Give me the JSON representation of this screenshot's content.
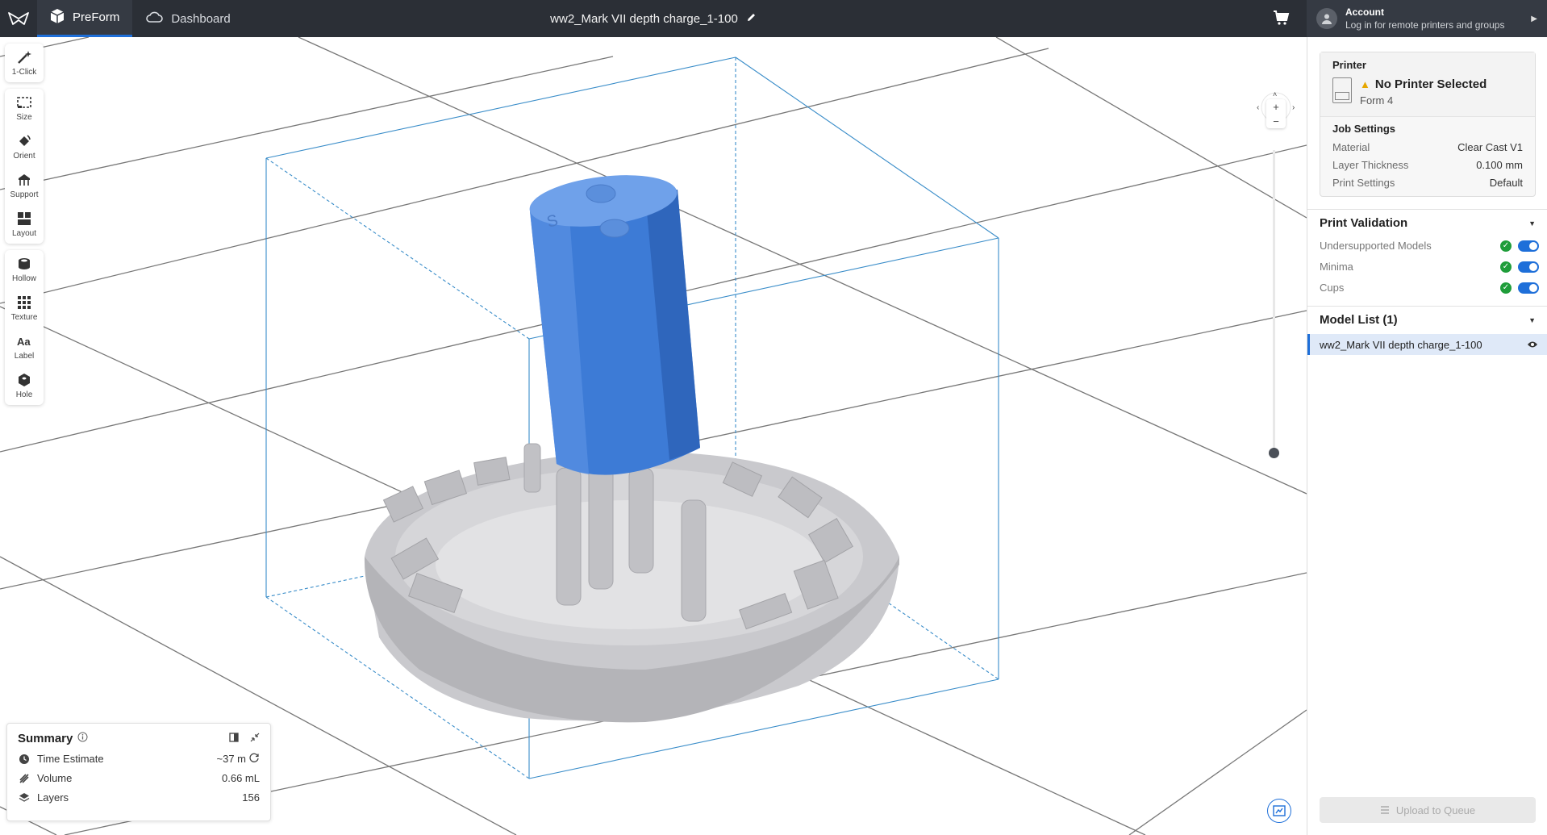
{
  "topbar": {
    "tabs": [
      {
        "label": "PreForm",
        "icon": "preform-box-icon",
        "active": true
      },
      {
        "label": "Dashboard",
        "icon": "cloud-icon",
        "active": false
      }
    ],
    "document_title": "ww2_Mark VII depth charge_1-100",
    "account": {
      "title": "Account",
      "subtitle": "Log in for remote printers and groups"
    }
  },
  "toolbar": {
    "group1": [
      {
        "label": "1-Click",
        "icon": "magic-wand-icon"
      }
    ],
    "group2": [
      {
        "label": "Size",
        "icon": "size-icon"
      },
      {
        "label": "Orient",
        "icon": "orient-icon"
      },
      {
        "label": "Support",
        "icon": "support-icon"
      },
      {
        "label": "Layout",
        "icon": "layout-icon"
      }
    ],
    "group3": [
      {
        "label": "Hollow",
        "icon": "hollow-icon"
      },
      {
        "label": "Texture",
        "icon": "texture-icon"
      },
      {
        "label": "Label",
        "icon": "label-icon"
      },
      {
        "label": "Hole",
        "icon": "hole-icon"
      }
    ]
  },
  "summary": {
    "title": "Summary",
    "rows": [
      {
        "label": "Time Estimate",
        "value": "~37 m",
        "icon": "clock-icon"
      },
      {
        "label": "Volume",
        "value": "0.66 mL",
        "icon": "resin-drop-icon"
      },
      {
        "label": "Layers",
        "value": "156",
        "icon": "layers-icon"
      }
    ]
  },
  "panel": {
    "printer": {
      "heading": "Printer",
      "status": "No Printer Selected",
      "model": "Form 4"
    },
    "job_settings": {
      "heading": "Job Settings",
      "rows": [
        {
          "key": "Material",
          "value": "Clear Cast V1"
        },
        {
          "key": "Layer Thickness",
          "value": "0.100 mm"
        },
        {
          "key": "Print Settings",
          "value": "Default"
        }
      ]
    },
    "validation": {
      "heading": "Print Validation",
      "items": [
        {
          "label": "Undersupported Models",
          "enabled": true
        },
        {
          "label": "Minima",
          "enabled": true
        },
        {
          "label": "Cups",
          "enabled": true
        }
      ]
    },
    "model_list": {
      "heading": "Model List (1)",
      "items": [
        {
          "name": "ww2_Mark VII depth charge_1-100"
        }
      ]
    },
    "upload_label": "Upload to Queue"
  },
  "colors": {
    "accent": "#1e6fd9",
    "topbar": "#2b2f36",
    "model_blue": "#3d7bd6",
    "model_grey": "#c8c8cc"
  }
}
